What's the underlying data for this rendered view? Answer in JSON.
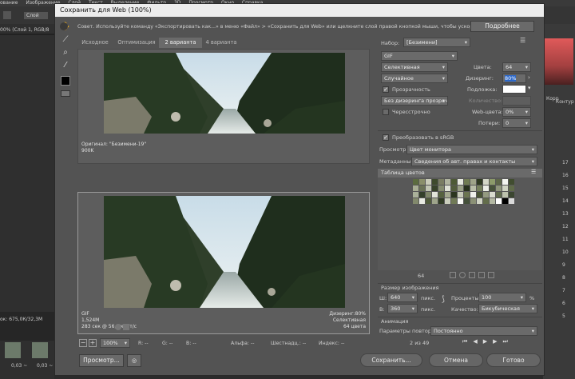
{
  "background_app": {
    "menu": [
      "ование",
      "Изображение",
      "Слой",
      "Текст",
      "Выделение",
      "Фильтр",
      "3D",
      "Просмотр",
      "Окно",
      "Справка"
    ],
    "layer_label": "Слой",
    "doc_info": "00% (Слой 1, RGB/8",
    "bottom_info": "ок: 675,0К/32,3М",
    "korrek_label": "Корр",
    "kontur_label": "Контур",
    "layer_numbers": [
      "17",
      "16",
      "15",
      "14",
      "13",
      "12",
      "11",
      "10",
      "9",
      "8",
      "7",
      "6",
      "5"
    ],
    "time_labels": [
      "0,03 ~",
      "0,03 ~"
    ]
  },
  "dialog": {
    "title": "Сохранить для Web (100%)",
    "tip": "Совет. Используйте команду «Экспортировать как...» в меню «Файл» > «Сохранить для Web» или щелкните слой правой кнопкой мыши, чтобы ускорить экспорт ресурсов",
    "more_button": "Подробнее",
    "tabs": [
      "Исходное",
      "Оптимизация",
      "2 варианта",
      "4 варианта"
    ],
    "active_tab": 2,
    "original_pane": {
      "line1": "Оригинал: \"Безимени-19\"",
      "line2": "900K"
    },
    "optimized_pane": {
      "left": [
        "GIF",
        "1,524M",
        "283 сек @ 56,6 кбит/с"
      ],
      "right": [
        "Дизеринг:80%",
        "Селективная",
        "64 цвета"
      ]
    },
    "zoom": "100%",
    "status": {
      "r": "R: --",
      "g": "G: --",
      "b": "B: --",
      "alpha": "Альфа: --",
      "hex": "Шестнадц.: --",
      "index": "Индекс: --"
    },
    "preview_button": "Просмотр...",
    "save_button": "Сохранить...",
    "cancel_button": "Отмена",
    "done_button": "Готово"
  },
  "settings": {
    "preset_label": "Набор:",
    "preset_value": "[Безимени]",
    "format": "GIF",
    "reduction": "Селективная",
    "colors_label": "Цвета:",
    "colors_value": "64",
    "dither_algo": "Случайное",
    "dither_label": "Дизеринг:",
    "dither_value": "80%",
    "transparency_label": "Прозрачность",
    "matte_label": "Подложка:",
    "transp_dither": "Без дизеринга прозрачн.",
    "amount_label": "Количество:",
    "interlaced_label": "Чересстрочно",
    "websnap_label": "Web-цвета:",
    "websnap_value": "0%",
    "lossy_label": "Потери:",
    "lossy_value": "0",
    "srgb_label": "Преобразовать в sRGB",
    "preview_label": "Просмотр:",
    "preview_value": "Цвет монитора",
    "metadata_label": "Метаданные:",
    "metadata_value": "Сведения об авт. правах и контакты",
    "color_table_title": "Таблица цветов",
    "color_count": "64",
    "image_size_title": "Размер изображения",
    "w_label": "Ш:",
    "w_value": "640",
    "h_label": "В:",
    "h_value": "360",
    "unit": "пикс.",
    "percent_label": "Проценты:",
    "percent_value": "100",
    "percent_unit": "%",
    "quality_label": "Качество:",
    "quality_value": "Бикубическая",
    "animation_title": "Анимация",
    "loop_label": "Параметры повторов:",
    "loop_value": "Постоянно",
    "frame_counter": "2 из 49"
  },
  "palette_colors": [
    "#5b6b3f",
    "#8a8f6b",
    "#c9cbb9",
    "#3e4a2c",
    "#7a7d63",
    "#b0b49f",
    "#4d5a36",
    "#e6e8df",
    "#6f7a52",
    "#9ea389",
    "#2f3a22",
    "#d3d6c7",
    "#8c9a6a",
    "#5d6648",
    "#f4f5f0",
    "#414d30",
    "#a8ae94",
    "#6b7357",
    "#c1c5b3",
    "#38432a",
    "#858c6f",
    "#dfe2d6",
    "#525d3d",
    "#999f86",
    "#27301c",
    "#b9bea9",
    "#75805c",
    "#eceee7",
    "#47523a",
    "#8f957b",
    "#cfd3c2",
    "#606b4a",
    "#aab19a",
    "#34402a",
    "#7e8668",
    "#e2e4da",
    "#56623f",
    "#a3a98f",
    "#2b351f",
    "#c5c9b7",
    "#6a7450",
    "#f0f1ec",
    "#4a5536",
    "#949a80",
    "#d8dbce",
    "#5f6a4c",
    "#bcc1ac",
    "#3b4630",
    "#82896c",
    "#e8eae2",
    "#505b3b",
    "#9fa58b",
    "#313c24",
    "#cacebc",
    "#707a56",
    "#f7f8f4",
    "#44503a",
    "#8b9176",
    "#d1d4c5",
    "#636d4b",
    "#b4b9a4",
    "#ffffff",
    "#000000",
    "#dadada"
  ]
}
